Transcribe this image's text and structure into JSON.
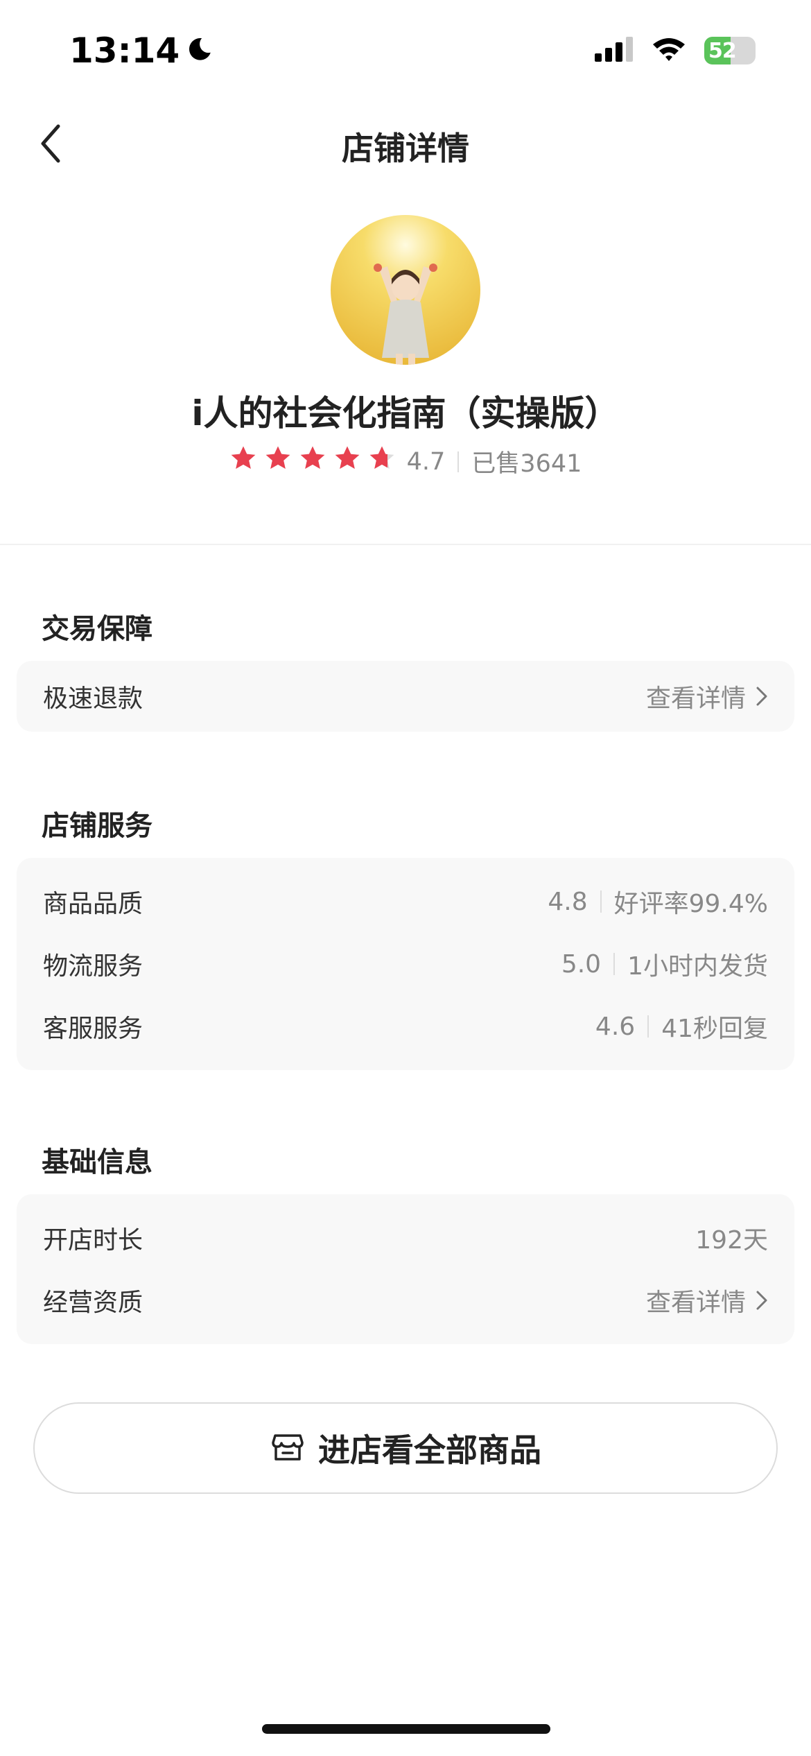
{
  "status_bar": {
    "time": "13:14",
    "battery": "52",
    "battery_level": 0.52
  },
  "nav": {
    "title": "店铺详情"
  },
  "shop": {
    "name": "i人的社会化指南（实操版）",
    "rating": "4.7",
    "rating_value": 4.7,
    "sold": "已售3641"
  },
  "trade_guarantee": {
    "title": "交易保障",
    "rows": [
      {
        "label": "极速退款",
        "link": "查看详情"
      }
    ]
  },
  "store_service": {
    "title": "店铺服务",
    "rows": [
      {
        "label": "商品品质",
        "score": "4.8",
        "detail": "好评率99.4%"
      },
      {
        "label": "物流服务",
        "score": "5.0",
        "detail": "1小时内发货"
      },
      {
        "label": "客服服务",
        "score": "4.6",
        "detail": "41秒回复"
      }
    ]
  },
  "basic_info": {
    "title": "基础信息",
    "rows": [
      {
        "label": "开店时长",
        "value": "192天"
      },
      {
        "label": "经营资质",
        "link": "查看详情"
      }
    ]
  },
  "enter_store": {
    "label": "进店看全部商品",
    "icon": "store-icon"
  },
  "colors": {
    "star": "#e8404f",
    "star_empty": "#dddddd",
    "battery": "#5ac35a"
  }
}
